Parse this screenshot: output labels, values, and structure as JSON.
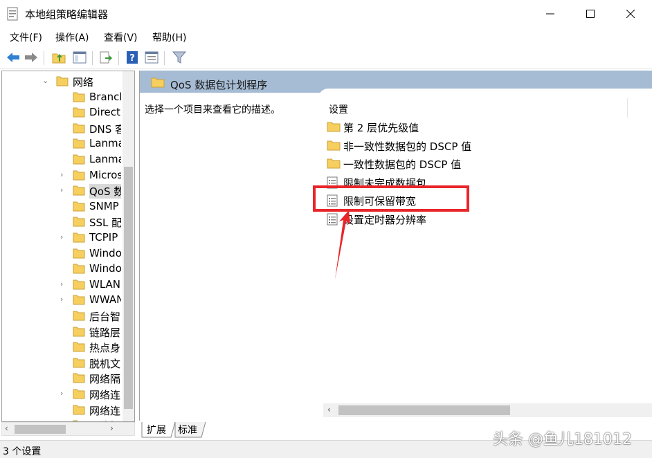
{
  "window": {
    "title": "本地组策略编辑器",
    "minimize_icon": "minimize-icon",
    "maximize_icon": "maximize-icon",
    "close_icon": "close-icon"
  },
  "menu": [
    "文件(F)",
    "操作(A)",
    "查看(V)",
    "帮助(H)"
  ],
  "toolbar": [
    "back-arrow-icon",
    "forward-arrow-icon",
    "up-folder-icon",
    "show-hide-tree-icon",
    "export-list-icon",
    "help-icon",
    "properties-icon",
    "filter-icon"
  ],
  "tree": [
    {
      "label": "网络",
      "chevron": "⌄"
    },
    {
      "label": "Branch",
      "chevron": ""
    },
    {
      "label": "Direct",
      "chevron": ""
    },
    {
      "label": "DNS 客",
      "chevron": ""
    },
    {
      "label": "Lanma",
      "chevron": ""
    },
    {
      "label": "Lanma",
      "chevron": ""
    },
    {
      "label": "Micros",
      "chevron": "›"
    },
    {
      "label": "QoS 数",
      "chevron": "›",
      "selected": true
    },
    {
      "label": "SNMP",
      "chevron": ""
    },
    {
      "label": "SSL 配",
      "chevron": ""
    },
    {
      "label": "TCPIP",
      "chevron": "›"
    },
    {
      "label": "Windo",
      "chevron": ""
    },
    {
      "label": "Windo",
      "chevron": ""
    },
    {
      "label": "WLAN",
      "chevron": "›"
    },
    {
      "label": "WWAN",
      "chevron": "›"
    },
    {
      "label": "后台智",
      "chevron": ""
    },
    {
      "label": "链路层",
      "chevron": ""
    },
    {
      "label": "热点身",
      "chevron": ""
    },
    {
      "label": "脱机文",
      "chevron": ""
    },
    {
      "label": "网络隔",
      "chevron": ""
    },
    {
      "label": "网络连",
      "chevron": "›"
    },
    {
      "label": "网络连",
      "chevron": ""
    },
    {
      "label": "网络提",
      "chevron": ""
    }
  ],
  "right": {
    "banner_title": "QoS 数据包计划程序",
    "description": "选择一个项目来查看它的描述。",
    "column_header": "设置",
    "settings": [
      {
        "label": "第 2 层优先级值",
        "icon": "folder"
      },
      {
        "label": "非一致性数据包的 DSCP 值",
        "icon": "folder"
      },
      {
        "label": "一致性数据包的 DSCP 值",
        "icon": "folder"
      },
      {
        "label": "限制未完成数据包",
        "icon": "setting"
      },
      {
        "label": "限制可保留带宽",
        "icon": "setting"
      },
      {
        "label": "设置定时器分辨率",
        "icon": "setting"
      }
    ]
  },
  "tabs": [
    "扩展",
    "标准"
  ],
  "status": "3 个设置",
  "watermark": "头条 @鱼儿181012",
  "colors": {
    "banner": "#a6bcd4",
    "highlight": "#e8262a",
    "folder": "#f6cf5e"
  }
}
